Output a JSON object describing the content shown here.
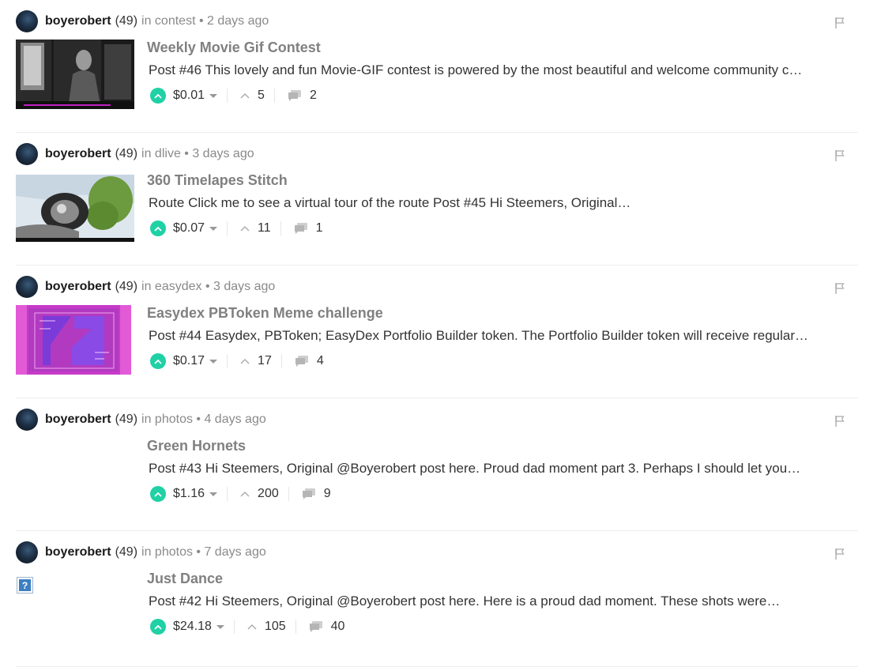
{
  "colors": {
    "upvote": "#1fd1a5",
    "title": "#808080",
    "meta": "#8a8a8a"
  },
  "icons": {
    "upvote": "chevron-up-icon",
    "votes": "caret-up-icon",
    "comments": "comments-icon",
    "flag": "flag-icon"
  },
  "posts": [
    {
      "author": "boyerobert",
      "reputation": "(49)",
      "meta": "in contest • 2 days ago",
      "title": "Weekly Movie Gif Contest",
      "summary": "Post #46 This lovely and fun Movie-GIF contest is powered by the most beautiful and welcome community c…",
      "payout": "$0.01",
      "votes": "5",
      "comments": "2",
      "thumb": "movie-still"
    },
    {
      "author": "boyerobert",
      "reputation": "(49)",
      "meta": "in dlive • 3 days ago",
      "title": "360 Timelapes Stitch",
      "summary": "Route Click me to see a virtual tour of the route Post #45 Hi Steemers, Original…",
      "payout": "$0.07",
      "votes": "11",
      "comments": "1",
      "thumb": "panorama"
    },
    {
      "author": "boyerobert",
      "reputation": "(49)",
      "meta": "in easydex • 3 days ago",
      "title": "Easydex PBToken Meme challenge",
      "summary": "Post #44 Easydex, PBToken; EasyDex Portfolio Builder token. The Portfolio Builder token will receive regular…",
      "payout": "$0.17",
      "votes": "17",
      "comments": "4",
      "thumb": "easydex-logo"
    },
    {
      "author": "boyerobert",
      "reputation": "(49)",
      "meta": "in photos • 4 days ago",
      "title": "Green Hornets",
      "summary": "Post #43 Hi Steemers, Original @Boyerobert post here. Proud dad moment part 3. Perhaps I should let you…",
      "payout": "$1.16",
      "votes": "200",
      "comments": "9",
      "thumb": ""
    },
    {
      "author": "boyerobert",
      "reputation": "(49)",
      "meta": "in photos • 7 days ago",
      "title": "Just Dance",
      "summary": "Post #42 Hi Steemers, Original @Boyerobert post here. Here is a proud dad moment. These shots were…",
      "payout": "$24.18",
      "votes": "105",
      "comments": "40",
      "thumb": "broken-image"
    }
  ]
}
